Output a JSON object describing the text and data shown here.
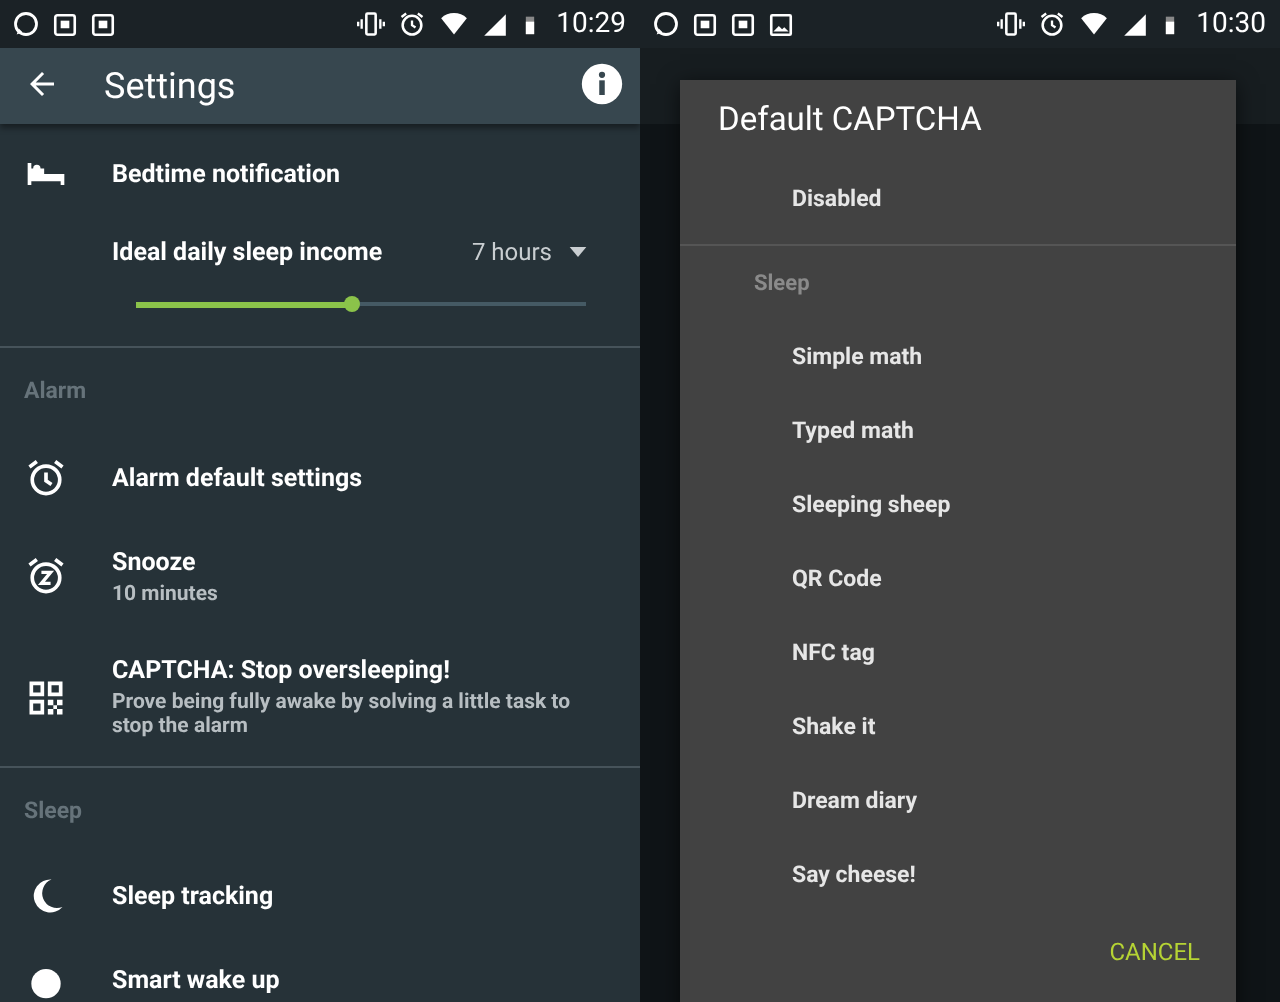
{
  "screens": [
    {
      "status_bar": {
        "time": "10:29"
      },
      "app_bar": {
        "title": "Settings"
      },
      "sections": [
        {
          "items": [
            {
              "kind": "plain",
              "title": "Bedtime notification"
            },
            {
              "kind": "slider",
              "title": "Ideal daily sleep income",
              "value": "7 hours",
              "level": 0.48
            }
          ]
        },
        {
          "header": "Alarm",
          "items": [
            {
              "kind": "plain",
              "title": "Alarm default settings"
            },
            {
              "kind": "plain",
              "title": "Snooze",
              "subtitle": "10 minutes"
            },
            {
              "kind": "plain",
              "title": "CAPTCHA: Stop oversleeping!",
              "subtitle": "Prove being fully awake by solving a little task to stop the alarm"
            }
          ]
        },
        {
          "header": "Sleep",
          "items": [
            {
              "kind": "plain",
              "title": "Sleep tracking"
            },
            {
              "kind": "plain",
              "title": "Smart wake up"
            }
          ]
        }
      ]
    },
    {
      "status_bar": {
        "time": "10:30"
      },
      "dialog": {
        "title": "Default CAPTCHA",
        "top_options": [
          "Disabled"
        ],
        "groups": [
          {
            "header": "Sleep",
            "options": [
              "Simple math",
              "Typed math",
              "Sleeping sheep",
              "QR Code",
              "NFC tag",
              "Shake it",
              "Dream diary",
              "Say cheese!"
            ]
          }
        ],
        "buttons": [
          "CANCEL"
        ]
      }
    }
  ]
}
